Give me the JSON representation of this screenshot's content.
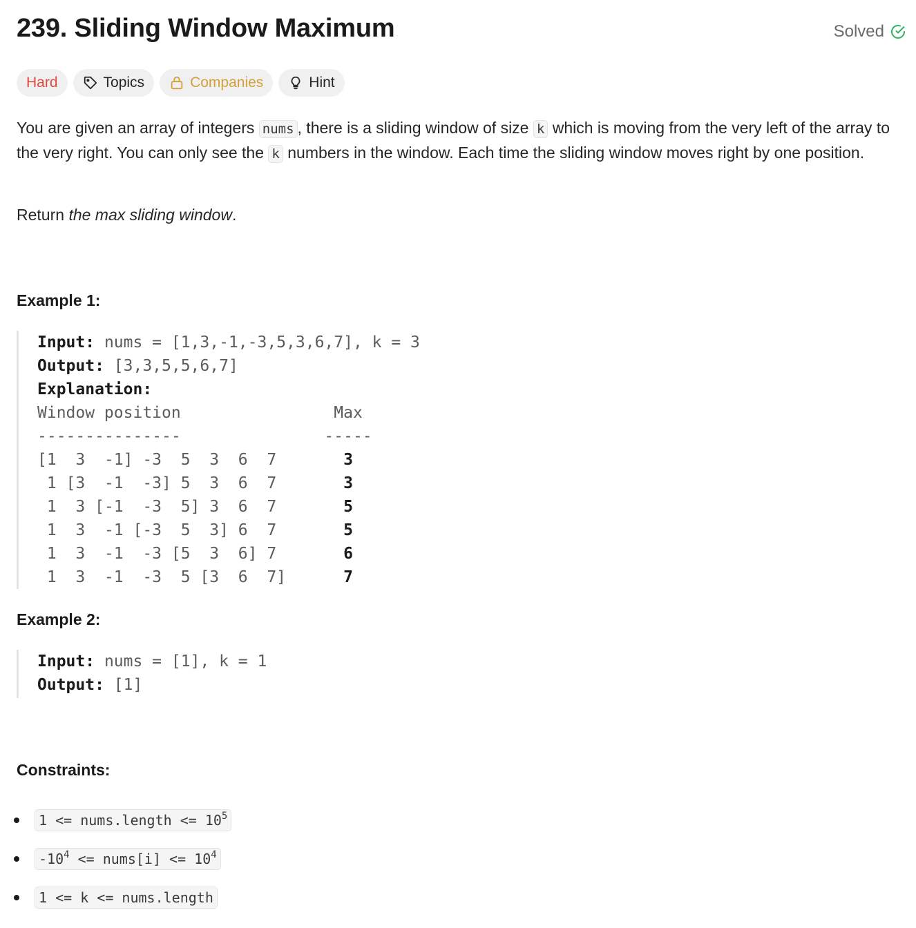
{
  "problem": {
    "title": "239. Sliding Window Maximum",
    "solved_label": "Solved"
  },
  "tags": {
    "difficulty": "Hard",
    "topics": "Topics",
    "companies": "Companies",
    "hint": "Hint"
  },
  "description": {
    "p1_a": "You are given an array of integers ",
    "code_nums": "nums",
    "p1_b": ", there is a sliding window of size ",
    "code_k": "k",
    "p1_c": " which is moving from the very left of the array to the very right. You can only see the ",
    "code_k2": "k",
    "p1_d": " numbers in the window. Each time the sliding window moves right by one position.",
    "return_prefix": "Return ",
    "return_em": "the max sliding window",
    "return_suffix": "."
  },
  "example1": {
    "heading": "Example 1:",
    "input_label": "Input:",
    "input_value": " nums = [1,3,-1,-3,5,3,6,7], k = 3",
    "output_label": "Output:",
    "output_value": " [3,3,5,5,6,7]",
    "explanation_label": "Explanation:",
    "table_header": "Window position                Max",
    "table_rule": "---------------               -----",
    "rows": [
      {
        "window": "[1  3  -1] -3  5  3  6  7       ",
        "max": "3"
      },
      {
        "window": " 1 [3  -1  -3] 5  3  6  7       ",
        "max": "3"
      },
      {
        "window": " 1  3 [-1  -3  5] 3  6  7       ",
        "max": "5"
      },
      {
        "window": " 1  3  -1 [-3  5  3] 6  7       ",
        "max": "5"
      },
      {
        "window": " 1  3  -1  -3 [5  3  6] 7       ",
        "max": "6"
      },
      {
        "window": " 1  3  -1  -3  5 [3  6  7]      ",
        "max": "7"
      }
    ]
  },
  "example2": {
    "heading": "Example 2:",
    "input_label": "Input:",
    "input_value": " nums = [1], k = 1",
    "output_label": "Output:",
    "output_value": " [1]"
  },
  "constraints": {
    "heading": "Constraints:",
    "c1_a": "1 <= nums.length <= 10",
    "c1_sup": "5",
    "c2_a": "-10",
    "c2_sup1": "4",
    "c2_b": " <= nums[i] <= 10",
    "c2_sup2": "4",
    "c3": "1 <= k <= nums.length"
  },
  "colors": {
    "hard": "#e04a3b",
    "companies": "#d4a03a",
    "solved_check": "#2db55d"
  }
}
